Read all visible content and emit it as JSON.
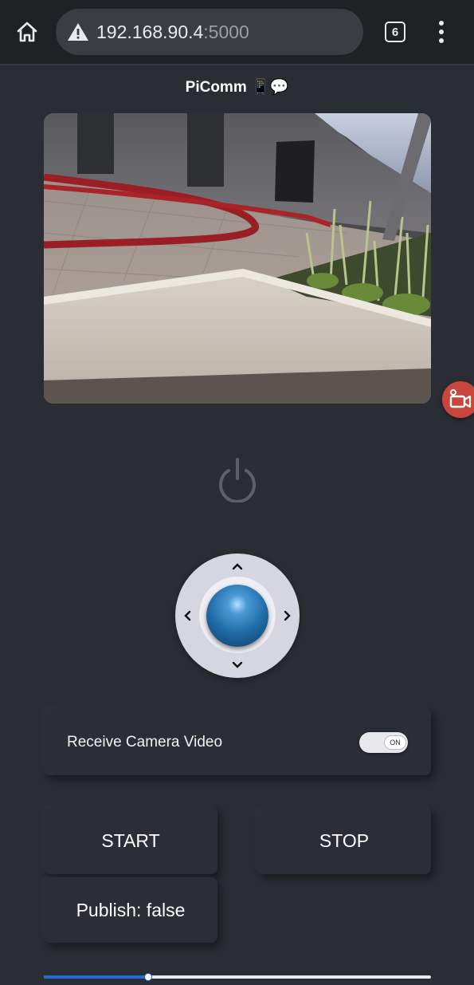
{
  "browser": {
    "url_host": "192.168.90.4",
    "url_port": ":5000",
    "tab_count": "6",
    "icons": [
      "home-icon",
      "warning-icon",
      "tabs-icon",
      "menu-icon"
    ]
  },
  "app": {
    "title": "PiComm 📱💬"
  },
  "camera": {
    "record_icon": "video-camera-icon"
  },
  "controls": {
    "power_icon": "power-icon",
    "joystick_arrows": [
      "chevron-up-icon",
      "chevron-left-icon",
      "chevron-right-icon",
      "chevron-down-icon"
    ]
  },
  "video_toggle": {
    "label": "Receive Camera Video",
    "state_text": "ON"
  },
  "buttons": {
    "start": "START",
    "stop": "STOP"
  },
  "publish": {
    "status": "Publish: false"
  },
  "slider": {
    "value_fraction": 0.27
  },
  "colors": {
    "background": "#2a2d34",
    "accent": "#1f6fdb",
    "record": "#c9463d"
  }
}
